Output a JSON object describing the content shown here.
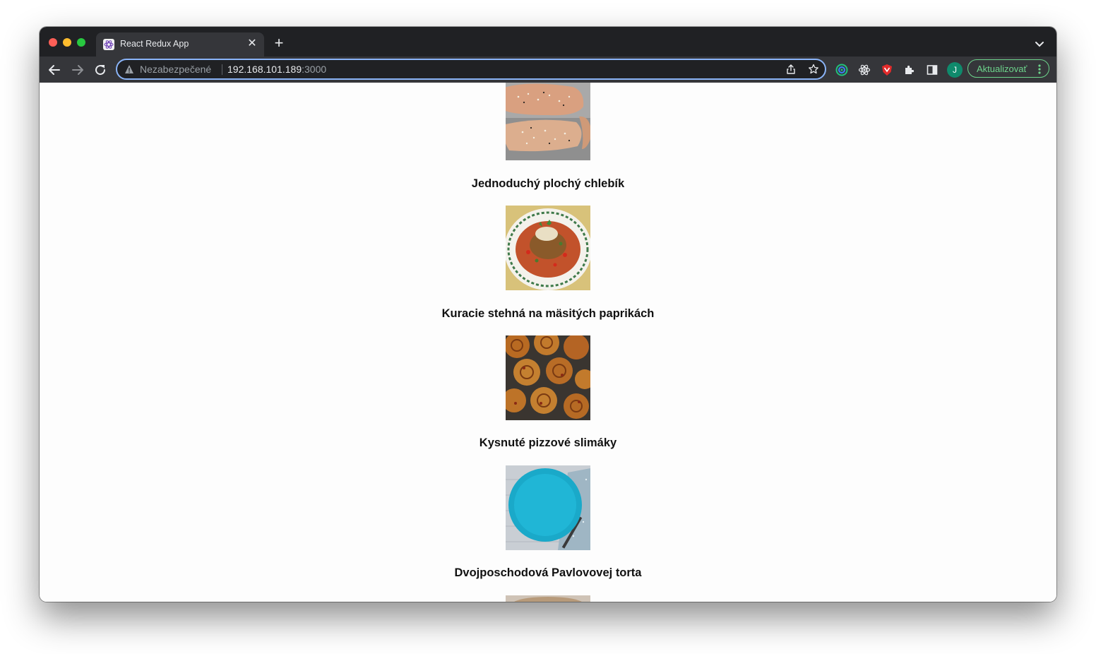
{
  "browser": {
    "tab": {
      "title": "React Redux App"
    },
    "address_bar": {
      "security_label": "Nezabezpečené",
      "url_host": "192.168.101.189",
      "url_port": ":3000"
    },
    "profile_initial": "J",
    "update_button_label": "Aktualizovať"
  },
  "recipes": [
    {
      "title": "Jednoduchý plochý chlebík",
      "image": "flatbread-photo"
    },
    {
      "title": "Kuracie stehná na mäsitých paprikách",
      "image": "chicken-pepper-stew-photo"
    },
    {
      "title": "Kysnuté pizzové slimáky",
      "image": "pizza-rolls-photo"
    },
    {
      "title": "Dvojposchodová Pavlovovej torta",
      "image": "blue-plate-photo"
    }
  ]
}
